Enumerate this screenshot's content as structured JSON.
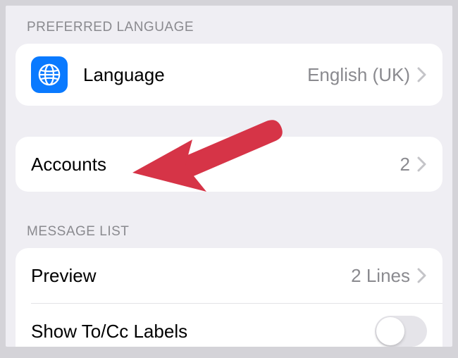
{
  "sections": {
    "language_header": "PREFERRED LANGUAGE",
    "message_list_header": "MESSAGE LIST"
  },
  "language_row": {
    "label": "Language",
    "value": "English (UK)",
    "icon": "globe"
  },
  "accounts_row": {
    "label": "Accounts",
    "value": "2"
  },
  "preview_row": {
    "label": "Preview",
    "value": "2 Lines"
  },
  "show_tocc_row": {
    "label": "Show To/Cc Labels",
    "toggle": false
  },
  "annotation": {
    "type": "arrow",
    "color": "#d63447",
    "points_to": "accounts_row"
  }
}
